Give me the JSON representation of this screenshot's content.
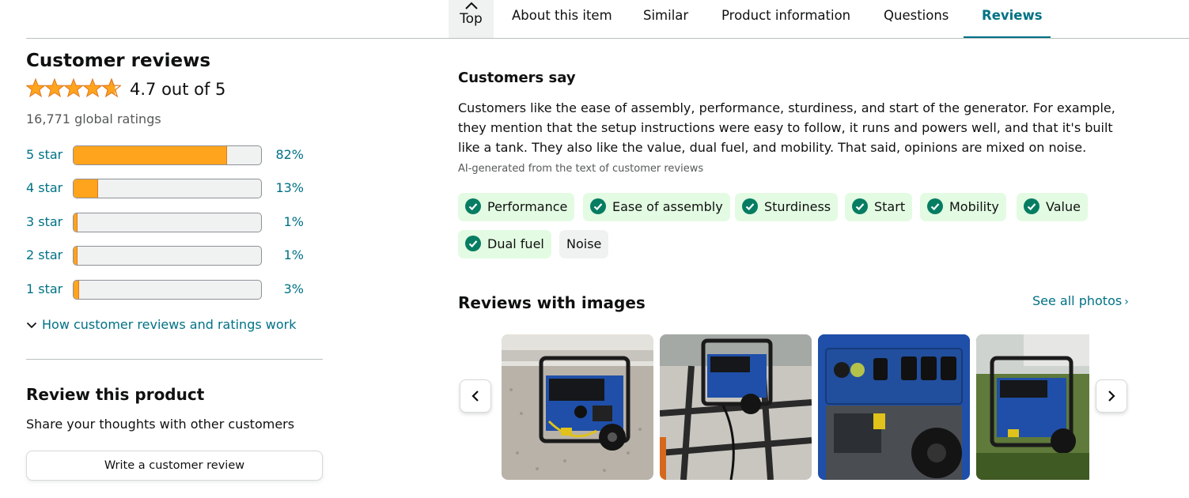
{
  "nav": {
    "top_label": "Top",
    "tabs": [
      {
        "label": "About this item"
      },
      {
        "label": "Similar"
      },
      {
        "label": "Product information"
      },
      {
        "label": "Questions"
      },
      {
        "label": "Reviews",
        "active": true
      }
    ]
  },
  "reviews": {
    "title": "Customer reviews",
    "rating_value": 4.7,
    "rating_text": "4.7 out of 5",
    "global_ratings": "16,771 global ratings",
    "histogram": [
      {
        "label": "5 star",
        "percent": 82,
        "percent_text": "82%"
      },
      {
        "label": "4 star",
        "percent": 13,
        "percent_text": "13%"
      },
      {
        "label": "3 star",
        "percent": 1,
        "percent_text": "1%"
      },
      {
        "label": "2 star",
        "percent": 1,
        "percent_text": "1%"
      },
      {
        "label": "1 star",
        "percent": 3,
        "percent_text": "3%"
      }
    ],
    "how_link": "How customer reviews and ratings work"
  },
  "review_product": {
    "title": "Review this product",
    "subtitle": "Share your thoughts with other customers",
    "button": "Write a customer review"
  },
  "customers_say": {
    "title": "Customers say",
    "text": "Customers like the ease of assembly, performance, sturdiness, and start of the generator. For example, they mention that the setup instructions were easy to follow, it runs and powers well, and that it's built like a tank. They also like the value, dual fuel, and mobility. That said, opinions are mixed on noise.",
    "ai_note": "AI-generated from the text of customer reviews",
    "aspects": [
      {
        "label": "Performance",
        "positive": true
      },
      {
        "label": "Ease of assembly",
        "positive": true
      },
      {
        "label": "Sturdiness",
        "positive": true
      },
      {
        "label": "Start",
        "positive": true
      },
      {
        "label": "Mobility",
        "positive": true
      },
      {
        "label": "Value",
        "positive": true
      },
      {
        "label": "Dual fuel",
        "positive": true
      },
      {
        "label": "Noise",
        "positive": false
      }
    ]
  },
  "images_section": {
    "title": "Reviews with images",
    "see_all": "See all photos",
    "see_all_chevron": "›",
    "image_count": 4
  },
  "colors": {
    "link": "#007185",
    "star": "#ffa41c",
    "chip_positive": "#e3fbe2",
    "check": "#067d62",
    "generator_blue": "#1f4fa8"
  },
  "icons": {
    "top": "chevron-up-icon",
    "how": "chevron-down-icon",
    "check": "check-circle-icon",
    "prev": "chevron-left-icon",
    "next": "chevron-right-icon"
  }
}
